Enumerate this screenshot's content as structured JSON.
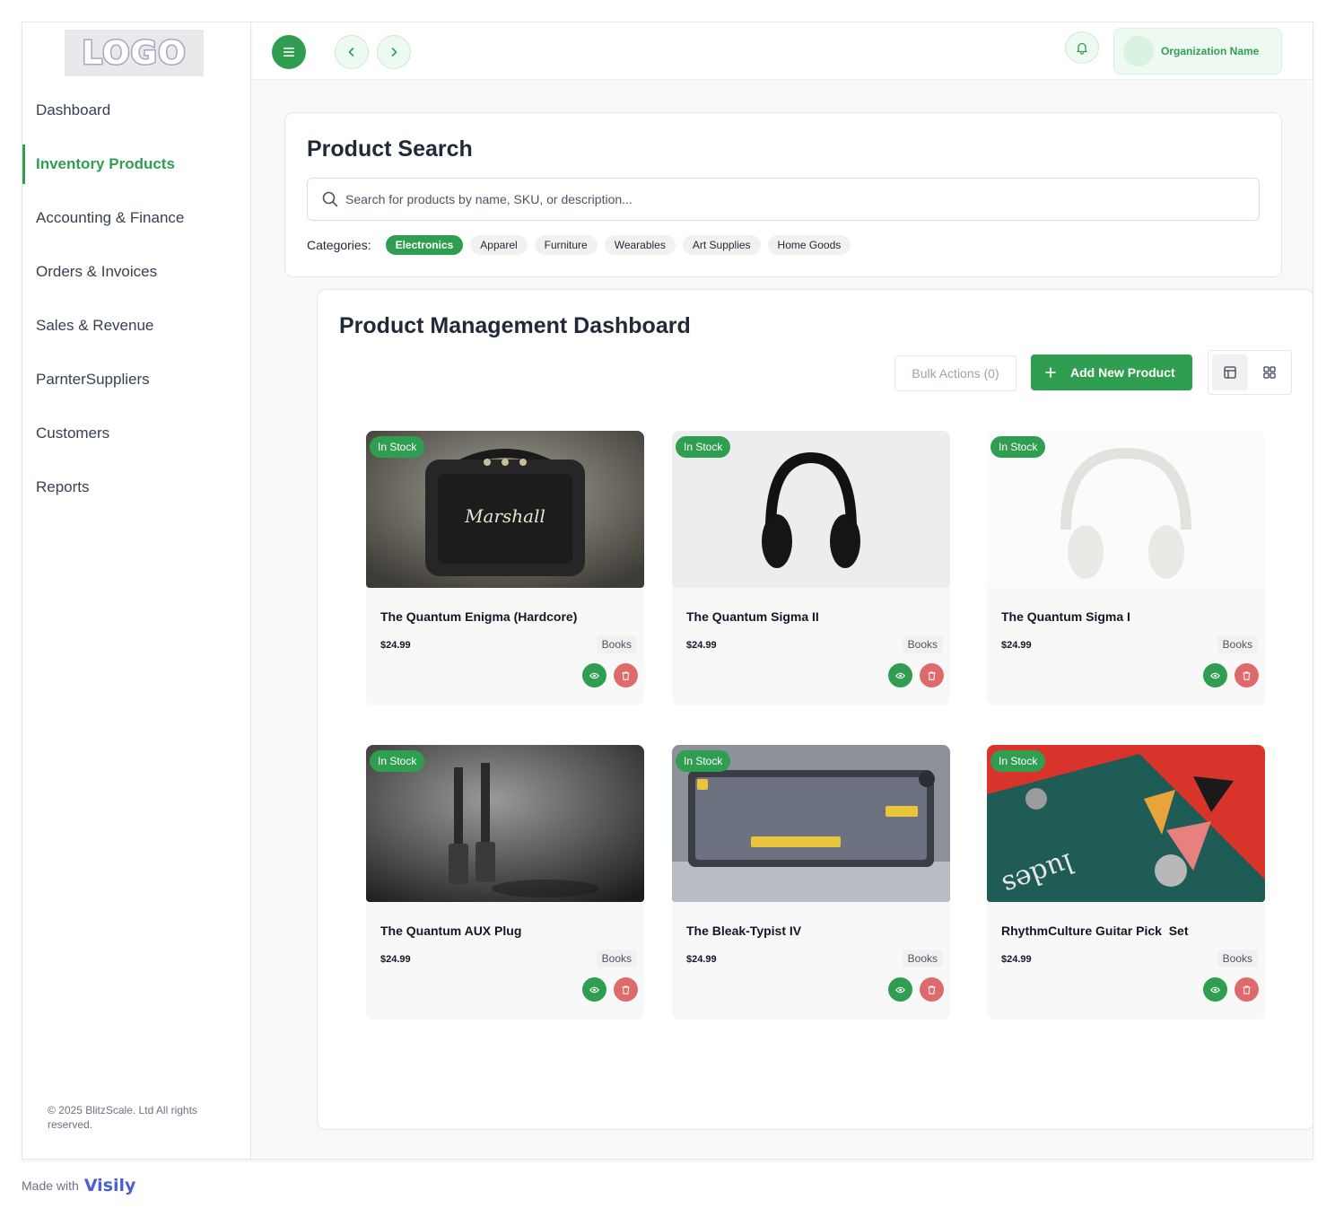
{
  "logo": {
    "text": "LOGO"
  },
  "sidebar": {
    "items": [
      {
        "label": "Dashboard",
        "active": false
      },
      {
        "label": "Inventory Products",
        "active": true
      },
      {
        "label": "Accounting & Finance",
        "active": false
      },
      {
        "label": "Orders & Invoices",
        "active": false
      },
      {
        "label": "Sales & Revenue",
        "active": false
      },
      {
        "label": "ParnterSuppliers",
        "active": false
      },
      {
        "label": "Customers",
        "active": false
      },
      {
        "label": "Reports",
        "active": false
      }
    ],
    "copyright": "© 2025 BlitzScale. Ltd All rights reserved."
  },
  "topbar": {
    "organization_name": "Organization Name"
  },
  "search": {
    "title": "Product Search",
    "placeholder": "Search for products by name, SKU, or description...",
    "categories_label": "Categories:",
    "categories": [
      {
        "label": "Electronics",
        "active": true
      },
      {
        "label": "Apparel",
        "active": false
      },
      {
        "label": "Furniture",
        "active": false
      },
      {
        "label": "Wearables",
        "active": false
      },
      {
        "label": "Art Supplies",
        "active": false
      },
      {
        "label": "Home Goods",
        "active": false
      }
    ]
  },
  "dashboard": {
    "title": "Product Management Dashboard",
    "bulk_actions_label": "Bulk Actions (0)",
    "add_product_label": "Add New Product",
    "products": [
      {
        "name": "The Quantum Enigma (Hardcore)",
        "price": "$24.99",
        "category": "Books",
        "status": "In Stock"
      },
      {
        "name": "The Quantum Sigma II",
        "price": "$24.99",
        "category": "Books",
        "status": "In Stock"
      },
      {
        "name": "The Quantum Sigma I",
        "price": "$24.99",
        "category": "Books",
        "status": "In Stock"
      },
      {
        "name": "The Quantum AUX Plug",
        "price": "$24.99",
        "category": "Books",
        "status": "In Stock"
      },
      {
        "name": "The Bleak-Typist IV",
        "price": "$24.99",
        "category": "Books",
        "status": "In Stock"
      },
      {
        "name": "RhythmCulture Guitar Pick  Set",
        "price": "$24.99",
        "category": "Books",
        "status": "In Stock"
      }
    ]
  },
  "footer": {
    "made_with": "Made with",
    "brand": "Visily"
  },
  "colors": {
    "accent": "#2f9e50",
    "danger": "#de6b6b",
    "chip_bg": "#f1f1f1"
  }
}
